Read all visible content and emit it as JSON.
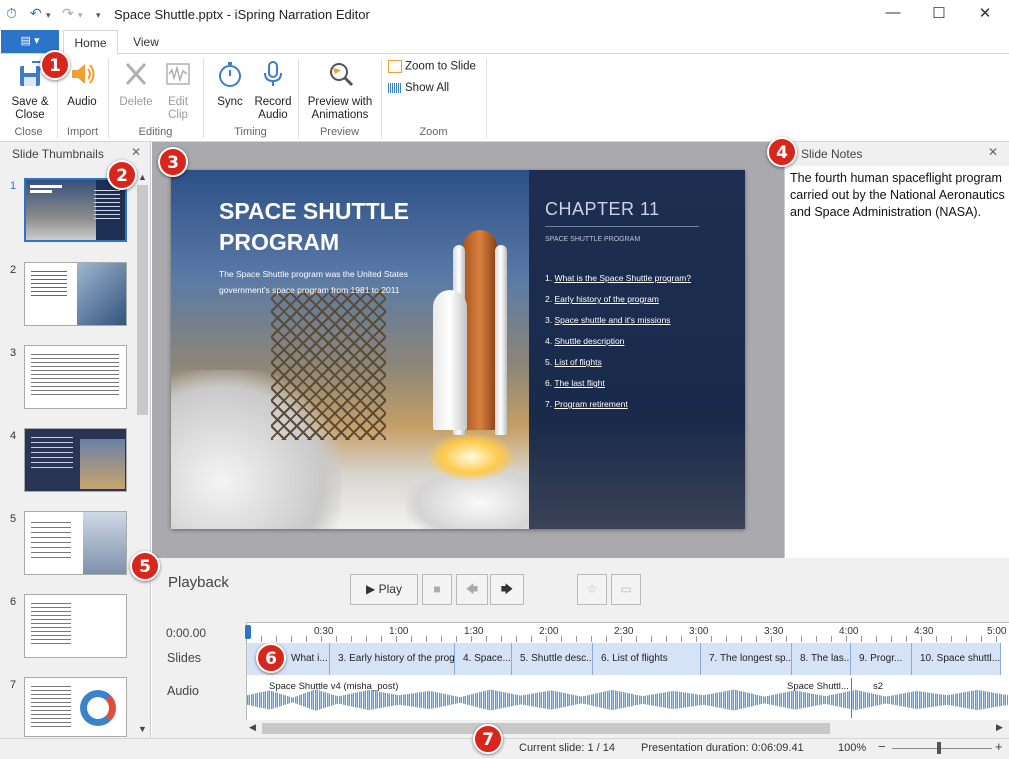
{
  "window": {
    "title": "Space Shuttle.pptx - iSpring Narration Editor"
  },
  "tabs": {
    "file": "▤ ▾",
    "home": "Home",
    "view": "View"
  },
  "ribbon": {
    "save": "Save &\nClose",
    "audio": "Audio",
    "delete": "Delete",
    "edit_clip": "Edit\nClip",
    "sync": "Sync",
    "record_audio": "Record\nAudio",
    "preview": "Preview with\nAnimations",
    "zoom_to_slide": "Zoom to Slide",
    "show_all": "Show All",
    "groups": {
      "close": "Close",
      "import": "Import",
      "editing": "Editing",
      "timing": "Timing",
      "preview": "Preview",
      "zoom": "Zoom"
    }
  },
  "thumbnails": {
    "title": "Slide Thumbnails",
    "numbers": [
      "1",
      "2",
      "3",
      "4",
      "5",
      "6",
      "7"
    ]
  },
  "slide": {
    "title": "SPACE SHUTTLE PROGRAM",
    "body": "The Space Shuttle program was the United States government's space program from 1981 to 2011",
    "chapter": "CHAPTER 11",
    "subtitle": "SPACE SHUTTLE PROGRAM",
    "items": [
      {
        "num": "1.",
        "text": "What is the Space Shuttle program?"
      },
      {
        "num": "2.",
        "text": "Early history of the program"
      },
      {
        "num": "3.",
        "text": "Space shuttle and it's missions"
      },
      {
        "num": "4.",
        "text": "Shuttle description"
      },
      {
        "num": "5.",
        "text": "List of flights"
      },
      {
        "num": "6.",
        "text": "The last flight"
      },
      {
        "num": "7.",
        "text": "Program retirement"
      }
    ]
  },
  "notes": {
    "title": "Slide Notes",
    "text": "The fourth human spaceflight program carried out by the National Aeronautics and Space Administration (NASA)."
  },
  "playback": {
    "title": "Playback",
    "play": "Play",
    "time": "0:00.00",
    "slides_label": "Slides",
    "audio_label": "Audio",
    "ticks": [
      "0:30",
      "1:00",
      "1:30",
      "2:00",
      "2:30",
      "3:00",
      "3:30",
      "4:00",
      "4:30",
      "5:00"
    ],
    "segments": [
      "What i...",
      "3. Early history of the prog...",
      "4. Space...",
      "5. Shuttle desc...",
      "6. List of flights",
      "7. The longest sp...",
      "8. The las...",
      "9. Progr...",
      "10. Space shuttl..."
    ],
    "audio_clips": [
      "Space Shuttle v4 (misha_post)",
      "Space Shuttl...",
      "s2"
    ]
  },
  "status": {
    "current_slide": "Current slide: 1 / 14",
    "duration": "Presentation duration: 0:06:09.41",
    "zoom": "100%"
  },
  "callouts": [
    "1",
    "2",
    "3",
    "4",
    "5",
    "6",
    "7"
  ],
  "colors": {
    "accent": "#2b74c7",
    "callout": "#d9261c",
    "segment": "#d6e3f6",
    "waveform": "#5b9bd5"
  }
}
